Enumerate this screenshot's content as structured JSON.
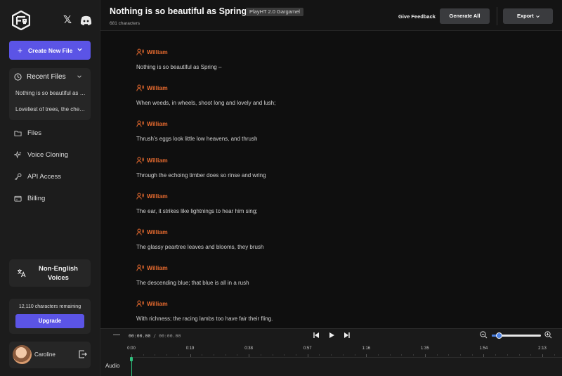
{
  "sidebar": {
    "create_label": "Create New File",
    "recent": {
      "header": "Recent Files",
      "items": [
        "Nothing is so beautiful as Spring –",
        "Loveliest of trees, the cherry now"
      ]
    },
    "nav": [
      {
        "label": "Files",
        "icon": "folder-icon"
      },
      {
        "label": "Voice Cloning",
        "icon": "sparkle-icon"
      },
      {
        "label": "API Access",
        "icon": "key-icon"
      },
      {
        "label": "Billing",
        "icon": "billing-icon"
      }
    ],
    "non_english": "Non-English Voices",
    "credits_text": "12,110 characters remaining",
    "upgrade_label": "Upgrade",
    "user_name": "Caroline"
  },
  "header": {
    "title": "Nothing is so beautiful as Spring…",
    "model": "PlayHT 2.0 Gargamel",
    "char_count": "681 characters",
    "feedback": "Give Feedback",
    "generate": "Generate All",
    "export": "Export"
  },
  "editor": {
    "blocks": [
      {
        "speaker": "William",
        "text": "Nothing is so beautiful as Spring –"
      },
      {
        "speaker": "William",
        "text": "When weeds, in wheels, shoot long and lovely and lush;"
      },
      {
        "speaker": "William",
        "text": "Thrush’s eggs look little low heavens, and thrush"
      },
      {
        "speaker": "William",
        "text": "Through the echoing timber does so rinse and wring"
      },
      {
        "speaker": "William",
        "text": "The ear, it strikes like lightnings to hear him sing;"
      },
      {
        "speaker": "William",
        "text": "The glassy peartree leaves and blooms, they brush"
      },
      {
        "speaker": "William",
        "text": "The descending blue; that blue is all in a rush"
      },
      {
        "speaker": "William",
        "text": "With richness; the racing lambs too have fair their fling."
      }
    ]
  },
  "timeline": {
    "minus": "—",
    "current_time": "00:00.00",
    "separator": " / ",
    "total_time": "00:00.00",
    "zoom_level": 0.15,
    "ticks": [
      "0:00",
      "0:19",
      "0:38",
      "0:57",
      "1:16",
      "1:35",
      "1:54",
      "2:13"
    ],
    "track_label": "Audio"
  },
  "colors": {
    "accent": "#5b54e6",
    "speaker": "#e86b2f",
    "playhead": "#2ec27e",
    "zoom": "#4a7fe0"
  }
}
